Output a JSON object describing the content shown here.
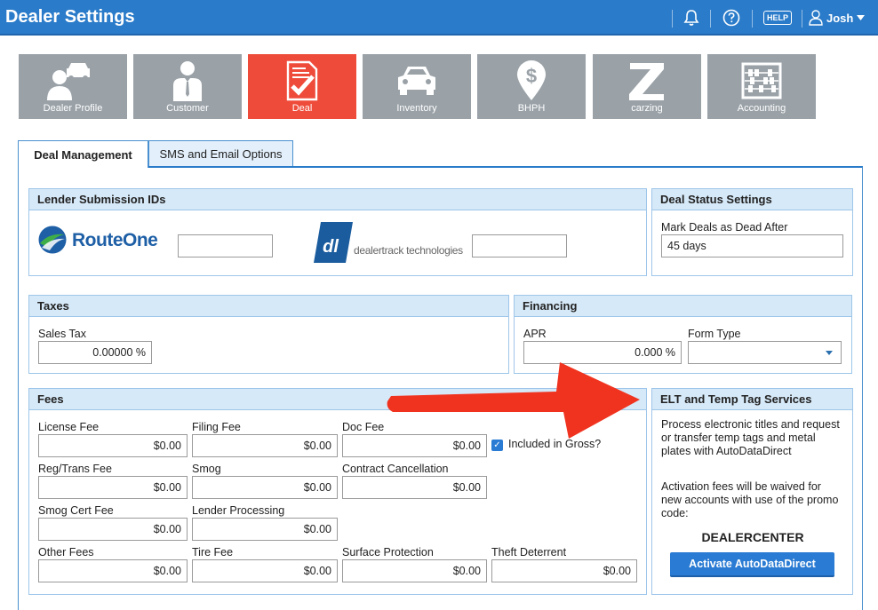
{
  "app": {
    "title": "Dealer Settings"
  },
  "header": {
    "bell_icon": "bell-icon",
    "question_icon": "question-circle-icon",
    "help_label": "HELP",
    "user_name": "Josh"
  },
  "tiles": [
    {
      "label": "Dealer Profile",
      "icon": "dealer-profile-icon"
    },
    {
      "label": "Customer",
      "icon": "customer-icon"
    },
    {
      "label": "Deal",
      "icon": "deal-document-icon"
    },
    {
      "label": "Inventory",
      "icon": "car-icon"
    },
    {
      "label": "BHPH",
      "icon": "dollar-pin-icon"
    },
    {
      "label": "carzing",
      "icon": "carzing-icon"
    },
    {
      "label": "Accounting",
      "icon": "abacus-icon"
    }
  ],
  "tabs": [
    {
      "label": "Deal Management"
    },
    {
      "label": "SMS and Email Options"
    }
  ],
  "lender": {
    "title": "Lender Submission IDs",
    "routeone_text": "RouteOne",
    "dealertrack_text": "dealertrack technologies",
    "routeone_value": "",
    "dealertrack_value": ""
  },
  "deal_status": {
    "title": "Deal Status Settings",
    "mark_dead_label": "Mark Deals as Dead After",
    "mark_dead_value": "45 days"
  },
  "taxes": {
    "title": "Taxes",
    "sales_tax_label": "Sales Tax",
    "sales_tax_value": "0.00000 %"
  },
  "financing": {
    "title": "Financing",
    "apr_label": "APR",
    "apr_value": "0.000 %",
    "form_type_label": "Form Type",
    "form_type_value": ""
  },
  "fees": {
    "title": "Fees",
    "license_fee": {
      "label": "License Fee",
      "value": "$0.00"
    },
    "filing_fee": {
      "label": "Filing Fee",
      "value": "$0.00"
    },
    "doc_fee": {
      "label": "Doc Fee",
      "value": "$0.00"
    },
    "included_in_gross": "Included in Gross?",
    "reg_trans_fee": {
      "label": "Reg/Trans Fee",
      "value": "$0.00"
    },
    "smog": {
      "label": "Smog",
      "value": "$0.00"
    },
    "contract_cancellation": {
      "label": "Contract Cancellation",
      "value": "$0.00"
    },
    "smog_cert_fee": {
      "label": "Smog Cert Fee",
      "value": "$0.00"
    },
    "lender_processing": {
      "label": "Lender Processing",
      "value": "$0.00"
    },
    "other_fees": {
      "label": "Other Fees",
      "value": "$0.00"
    },
    "tire_fee": {
      "label": "Tire Fee",
      "value": "$0.00"
    },
    "surface_protection": {
      "label": "Surface Protection",
      "value": "$0.00"
    },
    "theft_deterrent": {
      "label": "Theft Deterrent",
      "value": "$0.00"
    }
  },
  "elt": {
    "title": "ELT and Temp Tag Services",
    "description": "Process electronic titles and request or transfer temp tags and metal plates with AutoDataDirect",
    "activation": "Activation fees will be waived for new accounts with use of the promo code:",
    "promo_code": "DEALERCENTER",
    "button_label": "Activate AutoDataDirect"
  },
  "colors": {
    "header_blue": "#2a7bc9",
    "tile_gray": "#9aa2a8",
    "tile_active": "#ef4b3a",
    "panel_header": "#d6e9f8",
    "arrow_red": "#f0331f"
  }
}
